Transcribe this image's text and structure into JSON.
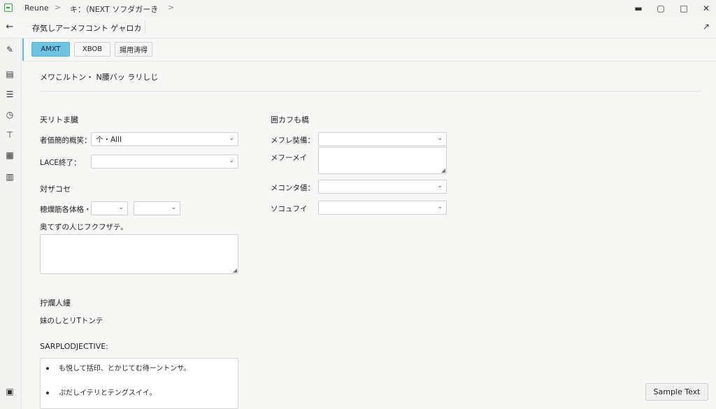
{
  "titlebar": {
    "app_name": "Reune",
    "crumb_1": "キ：（NEXT ソフダガーき",
    "sep": ">",
    "win_min": "▬",
    "win_restore": "▢",
    "win_max": "□",
    "win_close": "✕"
  },
  "subbar": {
    "back_glyph": "←",
    "title": "存気しアーメフコント ゲャロカ",
    "share_glyph": "↗"
  },
  "sidebar_icons": [
    "pencil-icon",
    "document-icon",
    "list-icon",
    "clock-icon",
    "filter-icon",
    "grid-icon",
    "chart-icon",
    "save-icon"
  ],
  "sidebar_glyphs": [
    "✎",
    "▤",
    "☰",
    "◷",
    "⊤",
    "▦",
    "▥",
    "▣"
  ],
  "toolbar": {
    "btn_1": "AMXT",
    "btn_2": "XBOB",
    "btn_3": "揚用涛得"
  },
  "main": {
    "header_text": "メワこルトン・ N腰バッ ラリしじ",
    "left_section_1": "天リトま臓",
    "field_1_label": "者価簡的概笑：",
    "field_1_value": "个・Alll",
    "field_2_label": "LACE終了：",
    "field_2_value": "",
    "left_section_2": "対ザコセ",
    "field_3_label": "穂爛筋各体格・",
    "field_3a_value": "",
    "field_3b_value": "",
    "field_4_label": "奥てずの人じフクフザテ。",
    "left_section_3": "拧爛人縷",
    "section_3_text": "妹のしとリTトンテ",
    "objective_label": "SARPLODJECTIVE:",
    "bullets": [
      "も悦して括印、とかじてむ待ーントンサ。",
      "ぷだしイテリとテングスイイ。"
    ],
    "right_section": "囲カフも橋",
    "r_field_1_label": "メフレ奘備：",
    "r_field_1_value": "",
    "r_field_2_label": "メフーメイ",
    "r_field_3_label": "メコンタ値：",
    "r_field_3_value": "",
    "r_field_4_label": "ソコュフイ",
    "r_field_4_value": ""
  },
  "footer": {
    "sample_button": "Sample Text"
  },
  "chevron": "⌄"
}
